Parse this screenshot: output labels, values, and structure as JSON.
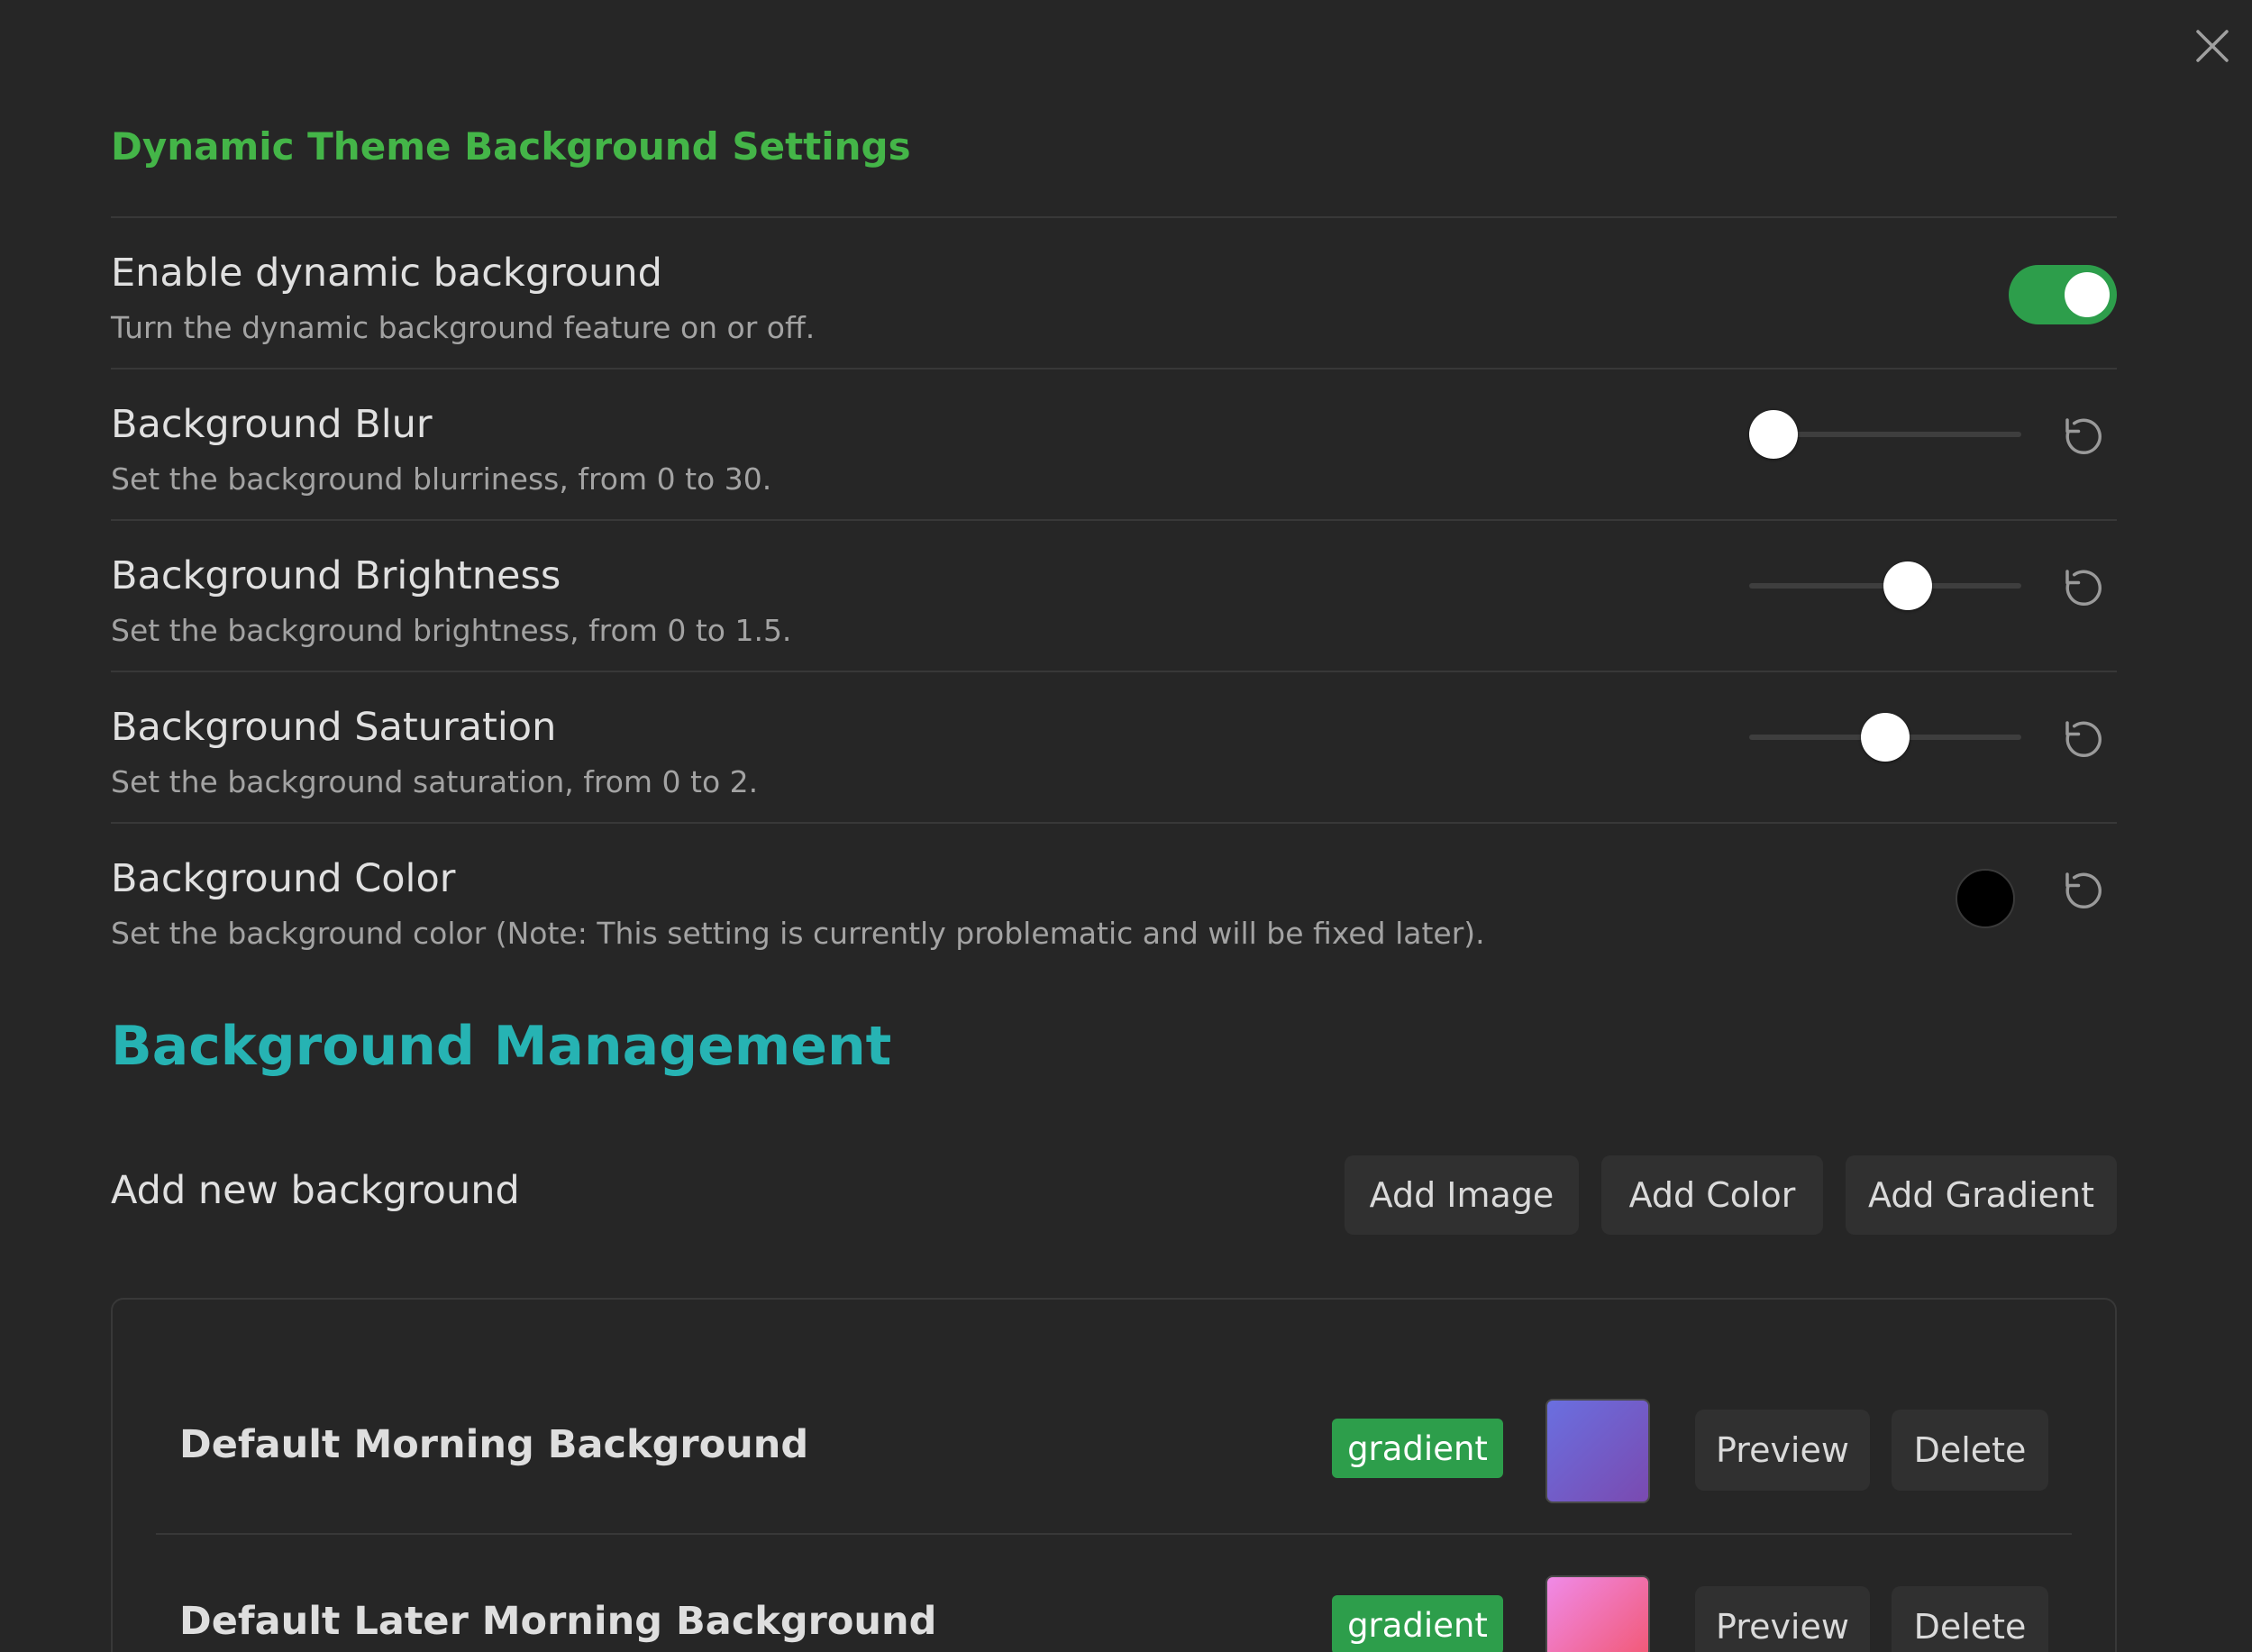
{
  "settings": {
    "title": "Dynamic Theme Background Settings",
    "enable": {
      "name": "Enable dynamic background",
      "desc": "Turn the dynamic background feature on or off.",
      "on": true
    },
    "blur": {
      "name": "Background Blur",
      "desc": "Set the background blurriness, from 0 to 30.",
      "min": 0,
      "max": 30,
      "value": 0
    },
    "brightness": {
      "name": "Background Brightness",
      "desc": "Set the background brightness, from 0 to 1.5.",
      "min": 0,
      "max": 1.5,
      "value": 0.9
    },
    "saturation": {
      "name": "Background Saturation",
      "desc": "Set the background saturation, from 0 to 2.",
      "min": 0,
      "max": 2,
      "value": 1.0
    },
    "color": {
      "name": "Background Color",
      "desc": "Set the background color (Note: This setting is currently problematic and will be fixed later).",
      "value": "#000000"
    }
  },
  "management": {
    "title": "Background Management",
    "add_label": "Add new background",
    "add_image": "Add Image",
    "add_color": "Add Color",
    "add_gradient": "Add Gradient",
    "backgrounds": [
      {
        "name": "Default Morning Background",
        "type": "gradient",
        "gradient_from": "#6a6fe0",
        "gradient_to": "#7a4ab0",
        "preview_label": "Preview",
        "delete_label": "Delete"
      },
      {
        "name": "Default Later Morning Background",
        "type": "gradient",
        "gradient_from": "#f08ae8",
        "gradient_to": "#f25368",
        "preview_label": "Preview",
        "delete_label": "Delete"
      }
    ]
  },
  "icons": {
    "close": "close-icon",
    "reset": "reset-icon"
  },
  "colors": {
    "accent_green": "#44b548",
    "accent_teal": "#26b3b3",
    "toggle_on": "#2d9e4b",
    "background": "#262626"
  }
}
